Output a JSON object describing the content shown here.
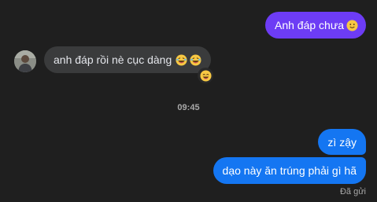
{
  "messages": {
    "out_1": {
      "text": "Anh đáp chưa",
      "emoji": "slightly-smiling-face"
    },
    "in_1": {
      "text": "anh đáp rồi nè cục dàng",
      "emojis": [
        "laughing-tears-face",
        "laughing-tears-face"
      ],
      "reaction": "laughing-face"
    },
    "out_2": {
      "text": "zì zậy"
    },
    "out_3": {
      "text": "dạo này ăn trúng phải gì hã"
    }
  },
  "timestamp": "09:45",
  "status": "Đã gửi",
  "colors": {
    "background": "#1f1f1f",
    "outgoing_violet": "#6d3cf5",
    "outgoing_blue": "#1476f2",
    "incoming": "#3a3b3c"
  }
}
